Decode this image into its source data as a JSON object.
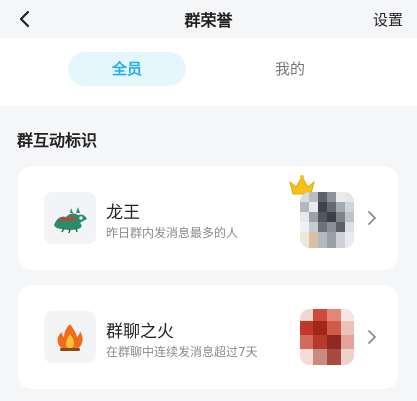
{
  "nav": {
    "title": "群荣誉",
    "settings_label": "设置"
  },
  "tabs": [
    {
      "label": "全员",
      "active": true
    },
    {
      "label": "我的",
      "active": false
    }
  ],
  "section": {
    "title": "群互动标识"
  },
  "cards": [
    {
      "name": "龙王",
      "description": "昨日群内发消息最多的人",
      "badge_icon": "dragon-icon",
      "avatar_decoration": "crown-icon"
    },
    {
      "name": "群聊之火",
      "description": "在群聊中连续发消息超过7天",
      "badge_icon": "fire-icon"
    }
  ],
  "colors": {
    "accent": "#22aee8",
    "active_tab_bg": "#e5f7fd",
    "page_bg": "#f5f6f8",
    "crown": "#f5c21a",
    "fire": "#f26a1b"
  }
}
